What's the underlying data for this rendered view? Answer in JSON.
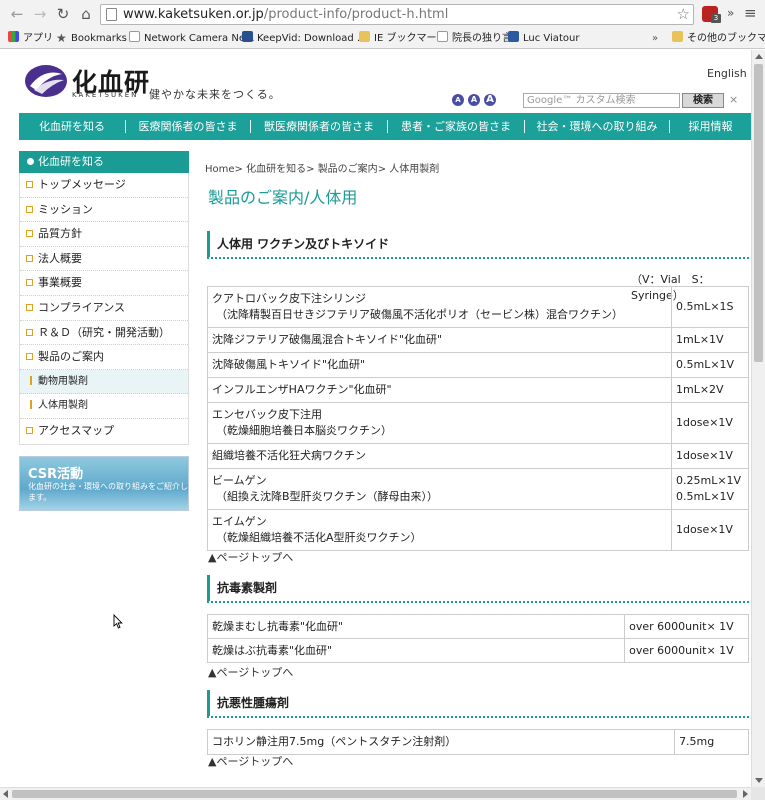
{
  "browser": {
    "url_host": "www.kaketsuken.or.jp",
    "url_path": "/product-info/product-h.html",
    "extension_badge": "3",
    "bookmarks": [
      {
        "label": "アプリ",
        "icon": "apps-grid-icon"
      },
      {
        "label": "Bookmarks",
        "icon": "star-icon"
      },
      {
        "label": "Network Camera Ne...",
        "icon": "page-icon"
      },
      {
        "label": "KeepVid: Download ...",
        "icon": "keepvid-icon"
      },
      {
        "label": "IE ブックマーク",
        "icon": "folder-icon"
      },
      {
        "label": "院長の独り言",
        "icon": "page-icon"
      },
      {
        "label": "Luc Viatour",
        "icon": "monitor-icon"
      },
      {
        "label": "その他のブックマーク",
        "icon": "folder-icon"
      }
    ],
    "overflow": "»"
  },
  "header": {
    "logo_text": "化血研",
    "logo_sub": "KAKETSUKEN",
    "tagline": "健やかな未来をつくる。",
    "english_link": "English",
    "font_size_buttons": [
      "A",
      "A",
      "A"
    ],
    "search_placeholder": "Google™ カスタム検索",
    "search_button": "検索",
    "clear": "×"
  },
  "global_nav": [
    "化血研を知る",
    "医療関係者の皆さま",
    "獣医療関係者の皆さま",
    "患者・ご家族の皆さま",
    "社会・環境への取り組み",
    "採用情報"
  ],
  "sidebar": {
    "heading": "化血研を知る",
    "items": [
      {
        "label": "トップメッセージ",
        "type": "main"
      },
      {
        "label": "ミッション",
        "type": "main"
      },
      {
        "label": "品質方針",
        "type": "main"
      },
      {
        "label": "法人概要",
        "type": "main"
      },
      {
        "label": "事業概要",
        "type": "main"
      },
      {
        "label": "コンプライアンス",
        "type": "main"
      },
      {
        "label": "Ｒ＆Ｄ（研究・開発活動）",
        "type": "main"
      },
      {
        "label": "製品のご案内",
        "type": "main"
      },
      {
        "label": "動物用製剤",
        "type": "sub"
      },
      {
        "label": "人体用製剤",
        "type": "sub"
      },
      {
        "label": "アクセスマップ",
        "type": "main"
      }
    ],
    "csr": {
      "title": "CSR活動",
      "desc": "化血研の社会・環境への取り組みをご紹介します。"
    }
  },
  "main": {
    "breadcrumb": [
      "Home",
      "化血研を知る",
      "製品のご案内",
      "人体用製剤"
    ],
    "breadcrumb_sep": ">",
    "title": "製品のご案内/人体用",
    "section1": {
      "heading": "人体用 ワクチン及びトキソイド",
      "note": "（V：Vial　S：Syringe）",
      "rows": [
        {
          "name": "クアトロバック皮下注シリンジ",
          "sub": "（沈降精製百日せきジフテリア破傷風不活化ポリオ（セービン株）混合ワクチン）",
          "spec": "0.5mL×1S"
        },
        {
          "name": "沈降ジフテリア破傷風混合トキソイド\"化血研\"",
          "sub": "",
          "spec": "1mL×1V"
        },
        {
          "name": "沈降破傷風トキソイド\"化血研\"",
          "sub": "",
          "spec": "0.5mL×1V"
        },
        {
          "name": "インフルエンザHAワクチン\"化血研\"",
          "sub": "",
          "spec": "1mL×2V"
        },
        {
          "name": "エンセバック皮下注用",
          "sub": "（乾燥細胞培養日本脳炎ワクチン）",
          "spec": "1dose×1V"
        },
        {
          "name": "組織培養不活化狂犬病ワクチン",
          "sub": "",
          "spec": "1dose×1V"
        },
        {
          "name": "ビームゲン",
          "sub": "（組換え沈降B型肝炎ワクチン（酵母由来））",
          "spec": "0.25mL×1V",
          "spec2": "0.5mL×1V"
        },
        {
          "name": "エイムゲン",
          "sub": "（乾燥組織培養不活化A型肝炎ワクチン）",
          "spec": "1dose×1V"
        }
      ]
    },
    "section2": {
      "heading": "抗毒素製剤",
      "rows": [
        {
          "name": "乾燥まむし抗毒素\"化血研\"",
          "spec": "over 6000unit× 1V"
        },
        {
          "name": "乾燥はぶ抗毒素\"化血研\"",
          "spec": "over 6000unit× 1V"
        }
      ]
    },
    "section3": {
      "heading": "抗悪性腫瘍剤",
      "rows": [
        {
          "name": "コホリン静注用7.5mg（ペントスタチン注射剤）",
          "spec": "7.5mg"
        }
      ]
    },
    "page_top": "▲ページトップへ"
  },
  "colors": {
    "brand_teal": "#1a9b94",
    "logo_purple": "#4b2f8f",
    "bullet_orange": "#e0a020"
  }
}
